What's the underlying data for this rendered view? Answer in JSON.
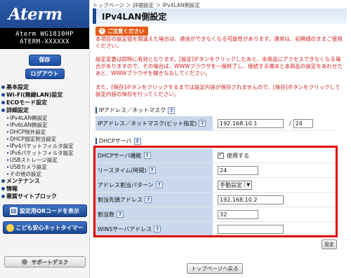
{
  "brand": {
    "logo": "Aterm"
  },
  "device": {
    "model": "Aterm WG1810HP",
    "name": "ATERM-XXXXXX"
  },
  "sidebar": {
    "save_label": "保存",
    "logout_label": "ログアウト",
    "menu": [
      {
        "label": "基本設定"
      },
      {
        "label": "Wi-Fi(無線LAN)設定"
      },
      {
        "label": "ECOモード設定"
      },
      {
        "label": "詳細設定"
      }
    ],
    "submenu": [
      {
        "label": "IPv4LAN側設定"
      },
      {
        "label": "IPv6LAN側設定"
      },
      {
        "label": "DHCP除外設定"
      },
      {
        "label": "DHCP固定割当設定"
      },
      {
        "label": "IPv4パケットフィルタ設定"
      },
      {
        "label": "IPv6パケットフィルタ設定"
      },
      {
        "label": "USBストレージ設定"
      },
      {
        "label": "USBカメラ設定"
      },
      {
        "label": "その他の設定"
      }
    ],
    "menu_bottom": [
      {
        "label": "メンテナンス"
      },
      {
        "label": "情報"
      },
      {
        "label": "悪質サイトブロック"
      }
    ],
    "qr_label": "設定用QRコードを表示",
    "kids_label": "こども安心ネットタイマー",
    "support_label": "サポートデスク"
  },
  "breadcrumb": [
    "トップページ",
    "＞",
    "詳細設定",
    "＞",
    "IPv4LAN側設定"
  ],
  "page": {
    "title": "IPv4LAN側設定",
    "notice_head": "ご注意ください",
    "notice_1": "本項目の設定値を間違えた場合は、通信ができなくなる可能性があります。通常は、初期値のままご使用ください。",
    "notice_2": "設定変更は即時に有効となります。[設定]ボタンをクリックしたあと、本商品にアクセスできなくなる場合がありますので、その場合は、WWWブラウザを一度終了し、接続する端末と本商品の設定をあわせたあと、WWWブラウザを開きなおしてください。",
    "notice_3": "また、[保存]ボタンをクリックするまでは設定内容が保存されませんので、[保存]ボタンをクリックして設定内容の保存を行ってください。"
  },
  "ip_section": {
    "title": "IPアドレス／ネットマスク",
    "help": "?",
    "label": "IPアドレス／ネットマスク(ビット指定)",
    "ip_value": "192.168.10.1",
    "separator": "/",
    "mask_value": "24"
  },
  "dhcp_section": {
    "title": "DHCPサーバ",
    "help": "?",
    "rows": {
      "function": {
        "label": "DHCPサーバ機能",
        "value": "使用する"
      },
      "lease": {
        "label": "リースタイム(時間)",
        "value": "24"
      },
      "pattern": {
        "label": "アドレス割当パターン",
        "value": "手動設定"
      },
      "start": {
        "label": "割当先頭アドレス",
        "value": "192.168.10.2"
      },
      "count": {
        "label": "割当数",
        "value": "32"
      },
      "wins": {
        "label": "WINSサーバアドレス",
        "value": ""
      }
    }
  },
  "buttons": {
    "set": "設定",
    "back": "トップページへ戻る"
  },
  "colors": {
    "accent": "#1f4a92",
    "warning": "#e85a14",
    "highlight": "#e00000",
    "label_bg": "#c9d8ec"
  }
}
